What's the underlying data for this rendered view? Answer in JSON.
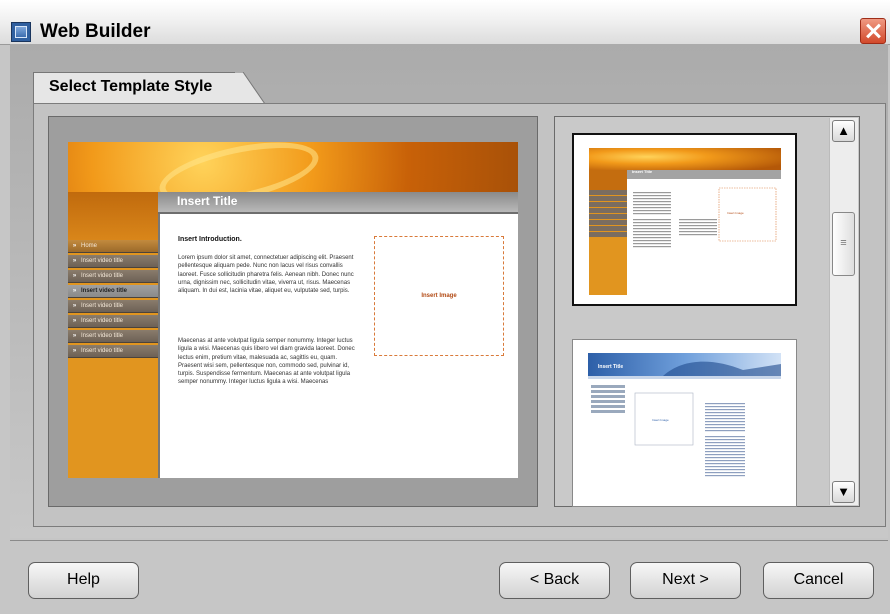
{
  "window": {
    "title": "Web Builder",
    "app_icon": "web-builder-icon",
    "close_icon": "close-icon"
  },
  "tab": {
    "label": "Select Template Style"
  },
  "preview": {
    "title": "Insert Title",
    "intro_heading": "Insert Introduction.",
    "paragraph1": "Lorem ipsum dolor sit amet, connectetuer adipiscing elit. Praesent pellentesque aliquam pede. Nunc non lacus vel risus convallis laoreet. Fusce sollicitudin pharetra felis. Aenean nibh. Donec nunc urna, dignissim nec, sollicitudin vitae, viverra ut, risus. Maecenas aliquam. In dui est, lacinia vitae, aliquet eu, vulputate sed, turpis.",
    "paragraph2": "Maecenas at ante volutpat ligula semper nonummy. Integer luctus ligula a wisi. Maecenas quis libero vel diam gravida laoreet. Donec lectus enim, pretium vitae, malesuada ac, sagittis eu, quam. Praesent wisi sem, pellentesque non, commodo sed, pulvinar id, turpis. Suspendisse fermentum. Maecenas at ante volutpat ligula semper nonummy. Integer luctus ligula a wisi. Maecenas",
    "image_label": "Insert Image",
    "nav": [
      {
        "label": "Home"
      },
      {
        "label": "Insert video title"
      },
      {
        "label": "Insert video title"
      },
      {
        "label": "Insert video title"
      },
      {
        "label": "Insert video title"
      },
      {
        "label": "Insert video title"
      },
      {
        "label": "Insert video title"
      },
      {
        "label": "Insert video title"
      }
    ],
    "nav_arrow": "»"
  },
  "templates": [
    {
      "title": "Insert Title",
      "image_label": "Insert Image",
      "selected": true
    },
    {
      "title": "Insert Title",
      "image_label": "Insert Image",
      "selected": false
    }
  ],
  "scrollbar": {
    "up": "▲",
    "down": "▼",
    "grip": "≡"
  },
  "buttons": {
    "help": "Help",
    "back": "< Back",
    "next": "Next >",
    "cancel": "Cancel"
  },
  "colors": {
    "accent_orange": "#e1951f",
    "thumb2_blue": "#2d5fa8"
  }
}
